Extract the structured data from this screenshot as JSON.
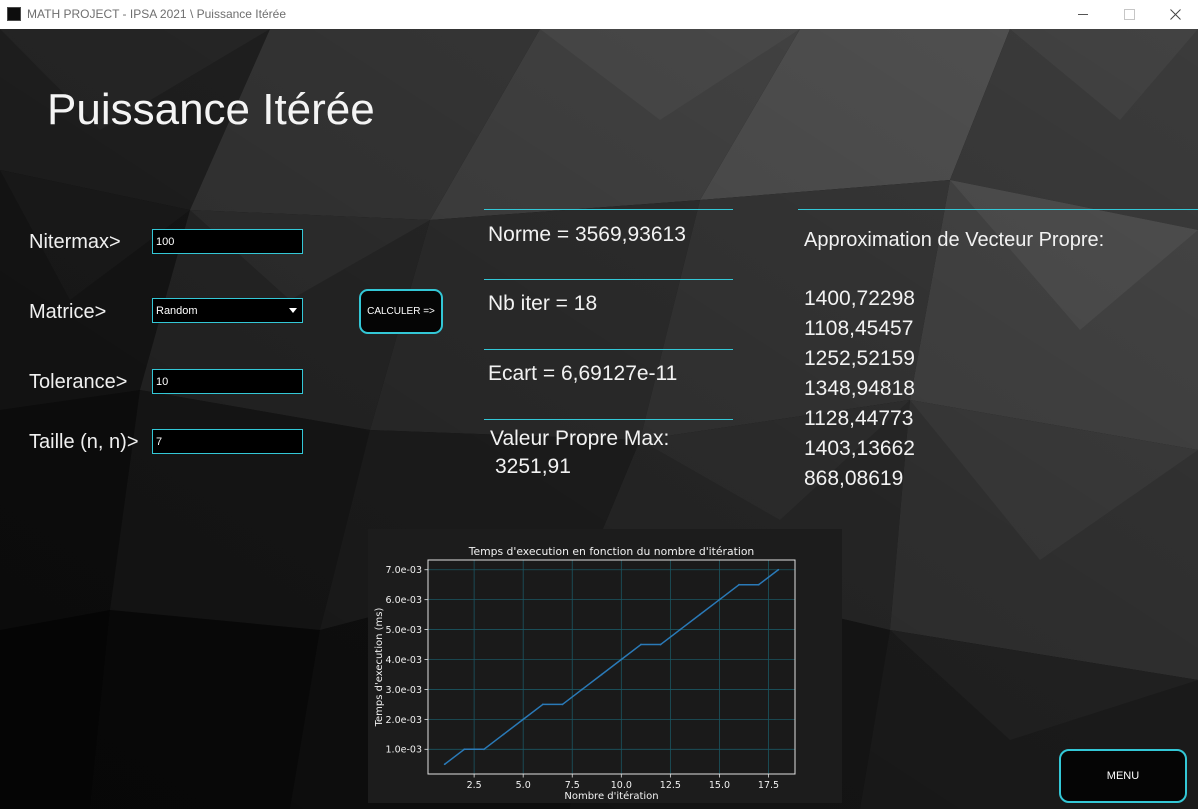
{
  "window": {
    "title": "MATH PROJECT - IPSA 2021 \\ Puissance Itérée",
    "icons": [
      "app-icon",
      "minimize-icon",
      "maximize-icon",
      "close-icon"
    ]
  },
  "page_title": "Puissance Itérée",
  "form": {
    "nitermax": {
      "label": "Nitermax>",
      "value": "100"
    },
    "matrice": {
      "label": "Matrice>",
      "value": "Random"
    },
    "tolerance": {
      "label": "Tolerance>",
      "value": "10"
    },
    "taille": {
      "label": "Taille (n, n)>",
      "value": "7"
    },
    "calculate_button": "CALCULER =>"
  },
  "results": {
    "norme": {
      "label": "Norme =",
      "value": "3569,93613"
    },
    "nb_iter": {
      "label": "Nb iter =",
      "value": "18"
    },
    "ecart": {
      "label": "Ecart =",
      "value": "6,69127e-11"
    },
    "valeur_propre_max": {
      "label": "Valeur Propre Max:",
      "value": "3251,91"
    }
  },
  "eigenvector": {
    "title": "Approximation de Vecteur Propre:",
    "values": [
      "1400,72298",
      "1108,45457",
      "1252,52159",
      "1348,94818",
      "1128,44773",
      "1403,13662",
      "868,08619"
    ]
  },
  "menu_button": "MENU",
  "colors": {
    "accent": "#33c7d6"
  },
  "chart_data": {
    "type": "line",
    "title": "Temps d'execution en fonction du nombre d'itération",
    "xlabel": "Nombre d'itération",
    "ylabel": "Temps d'execution (ms)",
    "x": [
      1,
      2,
      3,
      4,
      5,
      6,
      7,
      8,
      9,
      10,
      11,
      12,
      13,
      14,
      15,
      16,
      17,
      18
    ],
    "series": [
      {
        "values": [
          0.0005,
          0.001,
          0.001,
          0.0015,
          0.002,
          0.0025,
          0.0025,
          0.003,
          0.0035,
          0.004,
          0.0045,
          0.0045,
          0.005,
          0.0055,
          0.006,
          0.0065,
          0.0065,
          0.007
        ],
        "color": "#2a7ab8"
      }
    ],
    "xlim": [
      0.15,
      18.85
    ],
    "ylim": [
      0.000175,
      0.007325
    ],
    "xticks": [
      2.5,
      5.0,
      7.5,
      10.0,
      12.5,
      15.0,
      17.5
    ],
    "xtick_labels": [
      "2.5",
      "5.0",
      "7.5",
      "10.0",
      "12.5",
      "15.0",
      "17.5"
    ],
    "yticks": [
      0.001,
      0.002,
      0.003,
      0.004,
      0.005,
      0.006,
      0.007
    ],
    "ytick_labels": [
      "1.0e-03",
      "2.0e-03",
      "3.0e-03",
      "4.0e-03",
      "5.0e-03",
      "6.0e-03",
      "7.0e-03"
    ],
    "grid": true,
    "colors": {
      "background": "#1c1c1c",
      "plot": "#1a1a1a",
      "grid": "#1b5662",
      "axes": "#e0e0e0"
    }
  }
}
